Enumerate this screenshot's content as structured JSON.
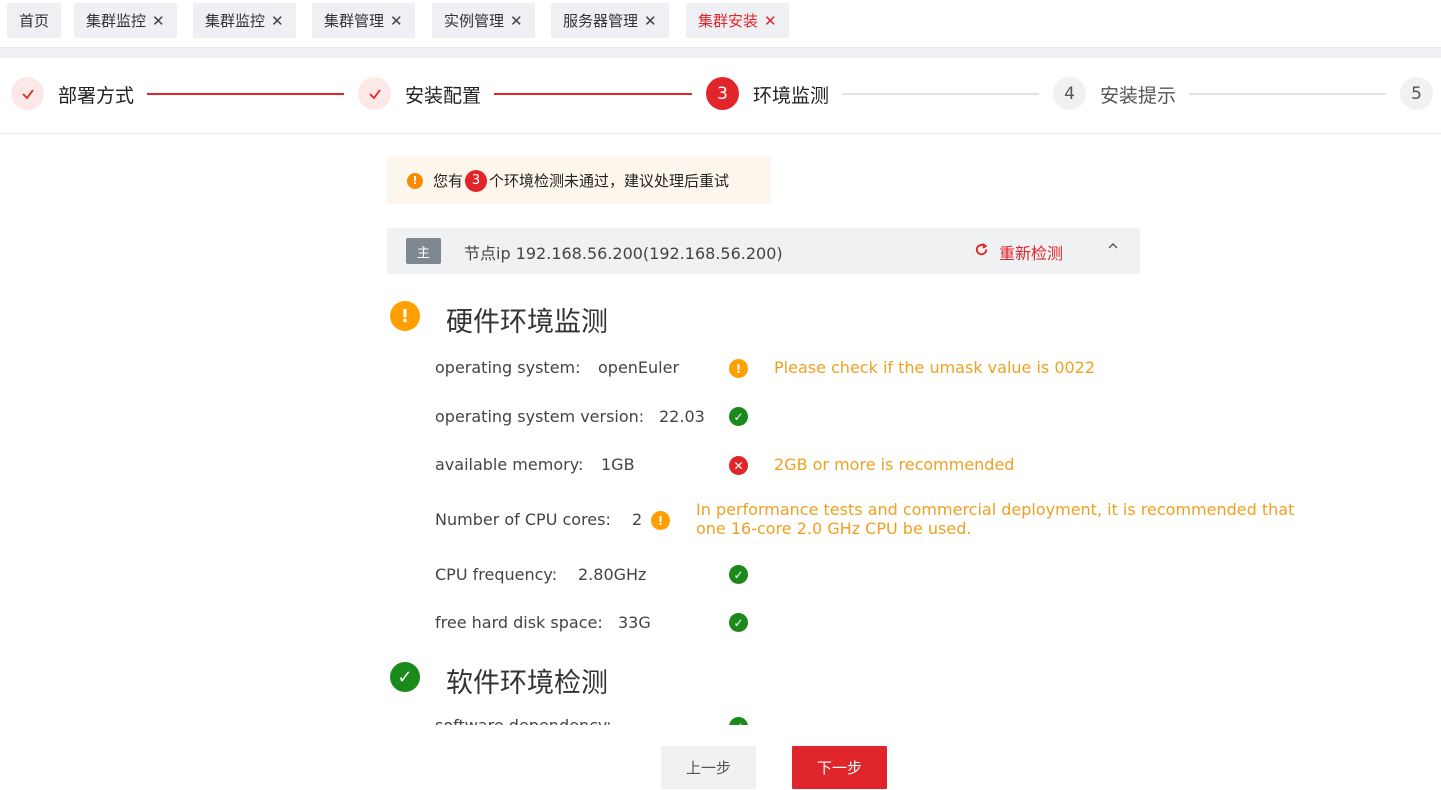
{
  "tabs": [
    {
      "label": "首页",
      "closable": false
    },
    {
      "label": "集群监控",
      "closable": true
    },
    {
      "label": "集群监控",
      "closable": true
    },
    {
      "label": "集群管理",
      "closable": true
    },
    {
      "label": "实例管理",
      "closable": true
    },
    {
      "label": "服务器管理",
      "closable": true
    },
    {
      "label": "集群安装",
      "closable": true,
      "active": true
    }
  ],
  "close_glyph": "✕",
  "steps": [
    {
      "number": "",
      "label": "部署方式",
      "state": "done"
    },
    {
      "number": "",
      "label": "安装配置",
      "state": "done"
    },
    {
      "number": "3",
      "label": "环境监测",
      "state": "current"
    },
    {
      "number": "4",
      "label": "安装提示",
      "state": "todo"
    },
    {
      "number": "5",
      "label": "",
      "state": "todo"
    }
  ],
  "alert": {
    "prefix": "您有",
    "count": "3",
    "suffix": "个环境检测未通过，建议处理后重试"
  },
  "node": {
    "badge": "主",
    "ip": "节点ip 192.168.56.200(192.168.56.200)",
    "recheck_label": "重新检测"
  },
  "hardware": {
    "title": "硬件环境监测",
    "status": "warn",
    "rows": [
      {
        "label": "operating system:",
        "value": "openEuler",
        "status": "warn",
        "message": "Please check if the umask value is 0022"
      },
      {
        "label": "operating system version:",
        "value": "22.03",
        "status": "ok",
        "message": ""
      },
      {
        "label": "available memory:",
        "value": "1GB",
        "status": "err",
        "message": "2GB or more is recommended"
      },
      {
        "label": "Number of CPU cores:",
        "value": "2",
        "status": "warn",
        "message_line1": "In performance tests and commercial deployment, it is recommended that",
        "message_line2": "one 16-core 2.0 GHz CPU be used."
      },
      {
        "label": "CPU frequency:",
        "value": "2.80GHz",
        "status": "ok",
        "message": ""
      },
      {
        "label": "free hard disk space:",
        "value": "33G",
        "status": "ok",
        "message": ""
      }
    ]
  },
  "software": {
    "title": "软件环境检测",
    "status": "ok",
    "first_row_label": "software dependency:"
  },
  "footer": {
    "prev_label": "上一步",
    "next_label": "下一步"
  },
  "colors": {
    "primary": "#e0262b",
    "warning": "#ffa000",
    "success": "#1a8a1a",
    "message": "#f0a020"
  }
}
